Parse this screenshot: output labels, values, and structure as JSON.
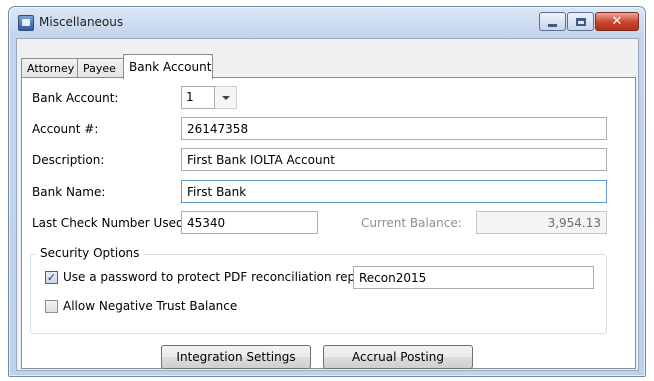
{
  "window": {
    "title": "Miscellaneous",
    "icon": "app-window-icon"
  },
  "tabs": [
    {
      "label": "Attorney",
      "active": false
    },
    {
      "label": "Payee",
      "active": false
    },
    {
      "label": "Bank Account",
      "active": true
    }
  ],
  "form": {
    "bank_account_label": "Bank Account:",
    "bank_account_value": "1",
    "account_number_label": "Account #:",
    "account_number_value": "26147358",
    "description_label": "Description:",
    "description_value": "First Bank IOLTA Account",
    "bank_name_label": "Bank Name:",
    "bank_name_value": "First Bank",
    "last_check_label": "Last Check Number Used:",
    "last_check_value": "45340",
    "current_balance_label": "Current Balance:",
    "current_balance_value": "3,954.13"
  },
  "security": {
    "title": "Security Options",
    "password_check_label": "Use a password to protect PDF reconciliation reports:",
    "password_checked": true,
    "password_value": "Recon2015",
    "negative_balance_label": "Allow Negative Trust Balance",
    "negative_balance_checked": false
  },
  "buttons": {
    "integration_settings": "Integration Settings",
    "accrual_posting": "Accrual Posting"
  },
  "colors": {
    "focus_border": "#5d9bd6",
    "title_bar": "#c3d5ec",
    "close_button": "#c9432d"
  }
}
